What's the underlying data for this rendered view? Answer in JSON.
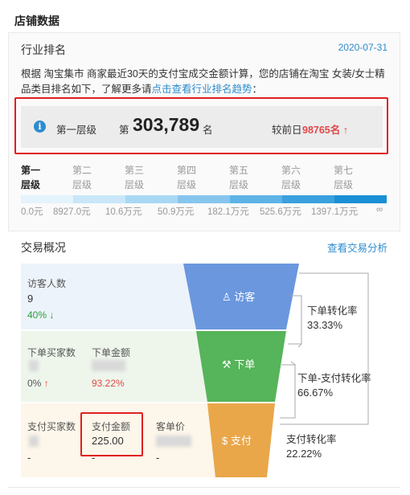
{
  "store": {
    "title": "店铺数据"
  },
  "ranking": {
    "title": "行业排名",
    "date": "2020-07-31",
    "desc_text": "根据 淘宝集市 商家最近30天的支付宝成交金额计算，您的店铺在淘宝 女装/女士精品类目排名如下，了解更多请",
    "desc_link": "点击查看行业排名趋势",
    "desc_end": "：",
    "level_label": "第一层级",
    "rank_prefix": "第",
    "rank_value": "303,789",
    "rank_suffix": "名",
    "compare_label": "较前日",
    "compare_value": "98765名",
    "levels": [
      {
        "line1": "第一",
        "line2": "层级"
      },
      {
        "line1": "第二",
        "line2": "层级"
      },
      {
        "line1": "第三",
        "line2": "层级"
      },
      {
        "line1": "第四",
        "line2": "层级"
      },
      {
        "line1": "第五",
        "line2": "层级"
      },
      {
        "line1": "第六",
        "line2": "层级"
      },
      {
        "line1": "第七",
        "line2": "层级"
      }
    ],
    "ticks": [
      "0.0元",
      "8927.0元",
      "10.6万元",
      "50.9万元",
      "182.1万元",
      "525.6万元",
      "1397.1万元",
      "∞"
    ],
    "bar_colors": [
      "#e4f3fc",
      "#c9e7f9",
      "#a9d8f4",
      "#86c6ee",
      "#5eb3e6",
      "#3aa0de",
      "#1a8fd5"
    ]
  },
  "trade": {
    "title": "交易概况",
    "link": "查看交易分析",
    "visitors": {
      "label": "访客人数",
      "value": "9",
      "pct": "40%"
    },
    "buyers": {
      "label": "下单买家数",
      "pct": "0%"
    },
    "order_amount": {
      "label": "下单金额",
      "pct": "93.22%"
    },
    "pay_buyers": {
      "label": "支付买家数",
      "foot": "-"
    },
    "pay_amount": {
      "label": "支付金额",
      "value": "225.00",
      "foot": "-"
    },
    "unit_price": {
      "label": "客单价",
      "foot": "-"
    },
    "funnel": {
      "visit": {
        "label": "访客",
        "color": "#6a97de"
      },
      "order": {
        "label": "下单",
        "color": "#56b45a"
      },
      "pay": {
        "label": "支付",
        "color": "#e9a74a"
      }
    },
    "conv": {
      "order_label": "下单转化率",
      "order_value": "33.33%",
      "order_pay_label": "下单-支付转化率",
      "order_pay_value": "66.67%",
      "pay_label": "支付转化率",
      "pay_value": "22.22%"
    }
  }
}
